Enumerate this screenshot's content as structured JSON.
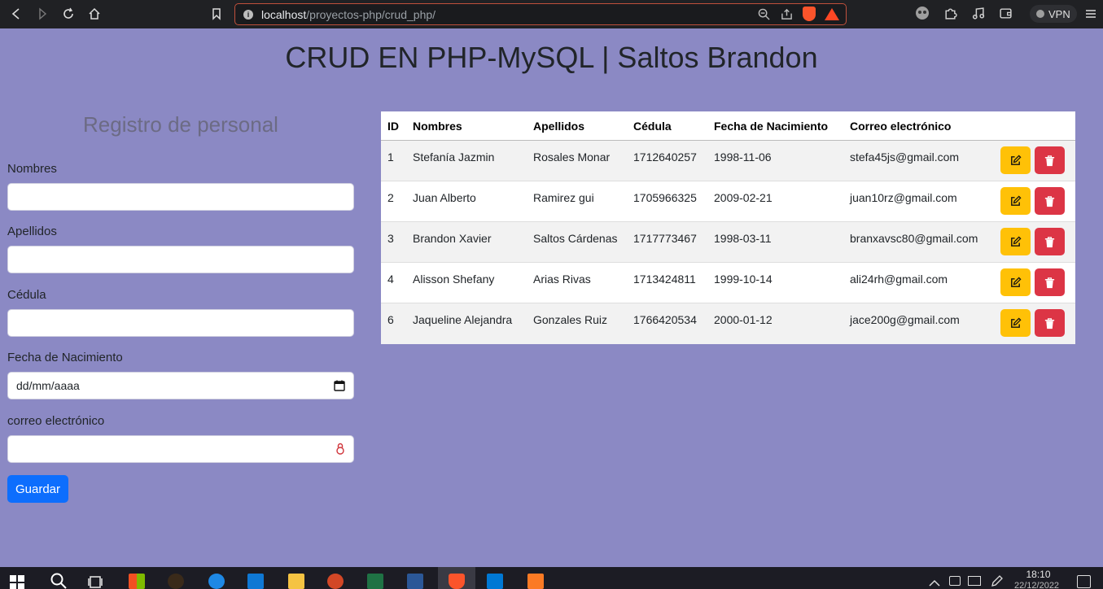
{
  "browser": {
    "url_host": "localhost",
    "url_path": "/proyectos-php/crud_php/",
    "vpn_label": "VPN"
  },
  "page": {
    "title": "CRUD EN PHP-MySQL | Saltos Brandon"
  },
  "form": {
    "title": "Registro de personal",
    "fields": [
      {
        "label": "Nombres",
        "value": ""
      },
      {
        "label": "Apellidos",
        "value": ""
      },
      {
        "label": "Cédula",
        "value": ""
      },
      {
        "label": "Fecha de Nacimiento",
        "placeholder": "dd/mm/aaaa"
      },
      {
        "label": "correo electrónico",
        "value": ""
      }
    ],
    "submit_label": "Guardar"
  },
  "table": {
    "headers": [
      "ID",
      "Nombres",
      "Apellidos",
      "Cédula",
      "Fecha de Nacimiento",
      "Correo electrónico"
    ],
    "rows": [
      {
        "id": "1",
        "nombres": "Stefanía Jazmin",
        "apellidos": "Rosales Monar",
        "cedula": "1712640257",
        "fecha": "1998-11-06",
        "correo": "stefa45js@gmail.com"
      },
      {
        "id": "2",
        "nombres": "Juan Alberto",
        "apellidos": "Ramirez gui",
        "cedula": "1705966325",
        "fecha": "2009-02-21",
        "correo": "juan10rz@gmail.com"
      },
      {
        "id": "3",
        "nombres": "Brandon Xavier",
        "apellidos": "Saltos Cárdenas",
        "cedula": "1717773467",
        "fecha": "1998-03-11",
        "correo": "branxavsc80@gmail.com"
      },
      {
        "id": "4",
        "nombres": "Alisson Shefany",
        "apellidos": "Arias Rivas",
        "cedula": "1713424811",
        "fecha": "1999-10-14",
        "correo": "ali24rh@gmail.com"
      },
      {
        "id": "6",
        "nombres": "Jaqueline Alejandra",
        "apellidos": "Gonzales Ruiz",
        "cedula": "1766420534",
        "fecha": "2000-01-12",
        "correo": "jace200g@gmail.com"
      }
    ],
    "edit_icon": "edit-icon",
    "delete_icon": "trash-icon"
  },
  "taskbar": {
    "time": "18:10",
    "date": "22/12/2022"
  },
  "colors": {
    "background": "#8b89c4",
    "primary": "#0d6efd",
    "warning": "#ffc107",
    "danger": "#dc3545"
  }
}
